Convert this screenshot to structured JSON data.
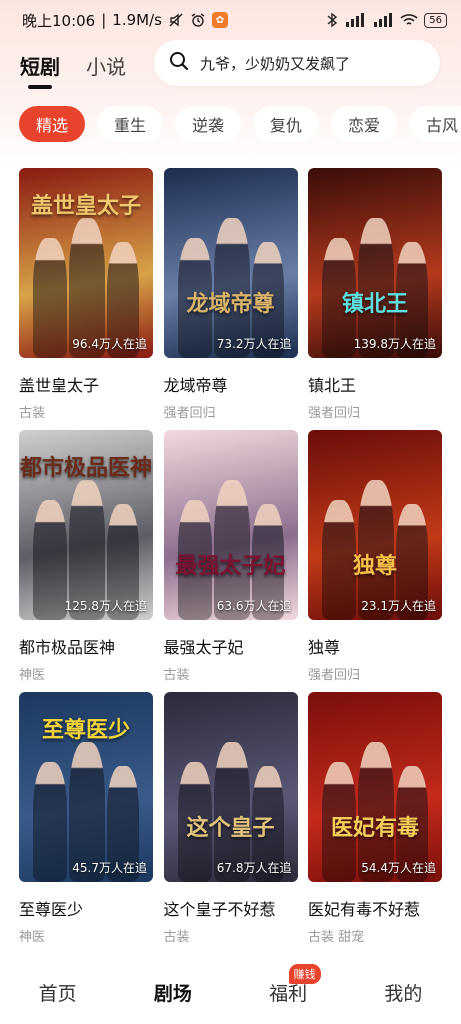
{
  "status_bar": {
    "time": "晚上10:06",
    "speed": "1.9M/s",
    "battery": "56",
    "icons": [
      "mute-icon",
      "alarm-icon",
      "app-badge-icon",
      "bluetooth-icon",
      "signal-icon",
      "signal-icon",
      "wifi-icon",
      "battery-icon"
    ]
  },
  "header": {
    "tabs": [
      {
        "label": "短剧",
        "active": true
      },
      {
        "label": "小说",
        "active": false
      }
    ],
    "search_text": "九爷，少奶奶又发飙了"
  },
  "chips": [
    "精选",
    "重生",
    "逆袭",
    "复仇",
    "恋爱",
    "古风"
  ],
  "dramas": [
    {
      "title": "盖世皇太子",
      "tag": "古装",
      "views": "96.4万人在追",
      "poster_text": "盖世皇太子",
      "colors": [
        "#8a1a12",
        "#d8a247",
        "#f0c66e"
      ]
    },
    {
      "title": "龙域帝尊",
      "tag": "强者回归",
      "views": "73.2万人在追",
      "poster_text": "龙域帝尊",
      "colors": [
        "#1c2d4f",
        "#6a7fa8",
        "#d9b36a"
      ]
    },
    {
      "title": "镇北王",
      "tag": "强者回归",
      "views": "139.8万人在追",
      "poster_text": "镇北王",
      "colors": [
        "#3a0d0a",
        "#b53a1d",
        "#5ee0e0"
      ]
    },
    {
      "title": "都市极品医神",
      "tag": "神医",
      "views": "125.8万人在追",
      "poster_text": "都市极品医神",
      "colors": [
        "#cfcfcf",
        "#5d5d66",
        "#6a2b1a"
      ]
    },
    {
      "title": "最强太子妃",
      "tag": "古装",
      "views": "63.6万人在追",
      "poster_text": "最强太子妃",
      "colors": [
        "#f2d9dd",
        "#8b6e8e",
        "#7a1230"
      ]
    },
    {
      "title": "独尊",
      "tag": "强者回归",
      "views": "23.1万人在追",
      "poster_text": "独尊",
      "colors": [
        "#6a0d0a",
        "#c23a17",
        "#f7c04a"
      ]
    },
    {
      "title": "至尊医少",
      "tag": "神医",
      "views": "45.7万人在追",
      "poster_text": "至尊医少",
      "colors": [
        "#1b3960",
        "#3a5b8a",
        "#f1d23a"
      ]
    },
    {
      "title": "这个皇子不好惹",
      "tag": "古装",
      "views": "67.8万人在追",
      "poster_text": "这个皇子",
      "colors": [
        "#2b2a3a",
        "#5a5876",
        "#e2c27a"
      ]
    },
    {
      "title": "医妃有毒不好惹",
      "tag": "古装 甜宠",
      "views": "54.4万人在追",
      "poster_text": "医妃有毒",
      "colors": [
        "#7a0f0a",
        "#c42a1c",
        "#f5cf5a"
      ]
    }
  ],
  "bottom_nav": [
    {
      "label": "首页",
      "active": false
    },
    {
      "label": "剧场",
      "active": true
    },
    {
      "label": "福利",
      "active": false,
      "badge": "赚钱"
    },
    {
      "label": "我的",
      "active": false
    }
  ]
}
